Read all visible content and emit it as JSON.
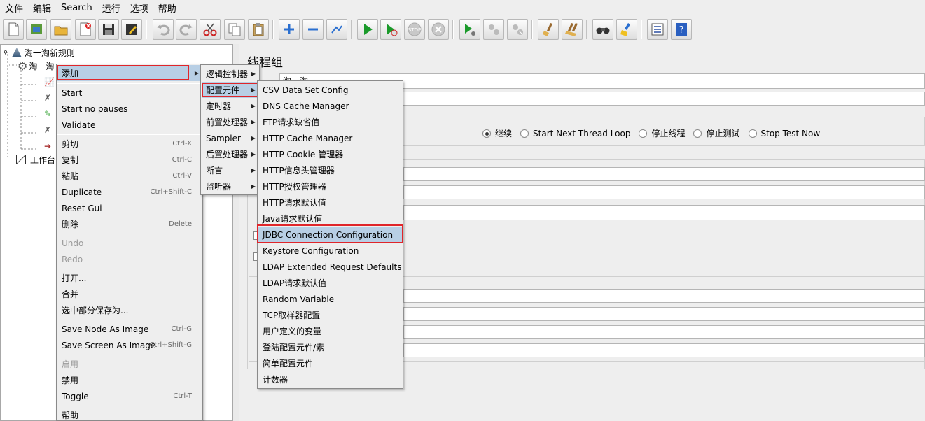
{
  "menubar": [
    "文件",
    "编辑",
    "Search",
    "运行",
    "选项",
    "帮助"
  ],
  "toolbar_icons": [
    "new-icon",
    "templates-icon",
    "open-icon",
    "close-icon",
    "save-icon",
    "save-as-icon",
    "undo-icon",
    "redo-icon",
    "cut-icon",
    "copy-icon",
    "paste-icon",
    "expand-icon",
    "collapse-icon",
    "toggle-icon",
    "start-icon",
    "start-no-pause-icon",
    "stop-icon",
    "shutdown-icon",
    "remote-start-icon",
    "remote-stop-icon",
    "remote-shutdown-icon",
    "clear-icon",
    "clear-all-icon",
    "search-icon",
    "reset-search-icon",
    "function-helper-icon",
    "help-icon"
  ],
  "tree": {
    "root": "淘一淘新规则",
    "thread_group": "淘一淘",
    "workbench": "工作台"
  },
  "right": {
    "title": "线程组",
    "name_value": "淘一淘",
    "on_error_options": [
      {
        "label": "继续",
        "selected": true
      },
      {
        "label": "Start Next Thread Loop",
        "selected": false
      },
      {
        "label": "停止线程",
        "selected": false
      },
      {
        "label": "停止测试",
        "selected": false
      },
      {
        "label": "Stop Test Now",
        "selected": false
      }
    ]
  },
  "context_menu": {
    "add": "添加",
    "start": "Start",
    "start_no_pauses": "Start no pauses",
    "validate": "Validate",
    "cut": "剪切",
    "cut_key": "Ctrl-X",
    "copy": "复制",
    "copy_key": "Ctrl-C",
    "paste": "粘贴",
    "paste_key": "Ctrl-V",
    "duplicate": "Duplicate",
    "duplicate_key": "Ctrl+Shift-C",
    "reset_gui": "Reset Gui",
    "delete": "删除",
    "delete_key": "Delete",
    "undo": "Undo",
    "redo": "Redo",
    "open": "打开...",
    "merge": "合并",
    "save_selection": "选中部分保存为...",
    "save_node_image": "Save Node As Image",
    "save_node_image_key": "Ctrl-G",
    "save_screen_image": "Save Screen As Image",
    "save_screen_image_key": "Ctrl+Shift-G",
    "enable": "启用",
    "disable": "禁用",
    "toggle": "Toggle",
    "toggle_key": "Ctrl-T",
    "help": "帮助"
  },
  "add_submenu": [
    "逻辑控制器",
    "配置元件",
    "定时器",
    "前置处理器",
    "Sampler",
    "后置处理器",
    "断言",
    "监听器"
  ],
  "config_submenu": [
    "CSV Data Set Config",
    "DNS Cache Manager",
    "FTP请求缺省值",
    "HTTP Cache Manager",
    "HTTP Cookie 管理器",
    "HTTP信息头管理器",
    "HTTP授权管理器",
    "HTTP请求默认值",
    "Java请求默认值",
    "JDBC Connection Configuration",
    "Keystore Configuration",
    "LDAP Extended Request Defaults",
    "LDAP请求默认值",
    "Random Variable",
    "TCP取样器配置",
    "用户定义的变量",
    "登陆配置元件/素",
    "简单配置元件",
    "计数器"
  ],
  "colors": {
    "highlight": "#b8cfe5",
    "annotation_red": "#e0252a"
  }
}
